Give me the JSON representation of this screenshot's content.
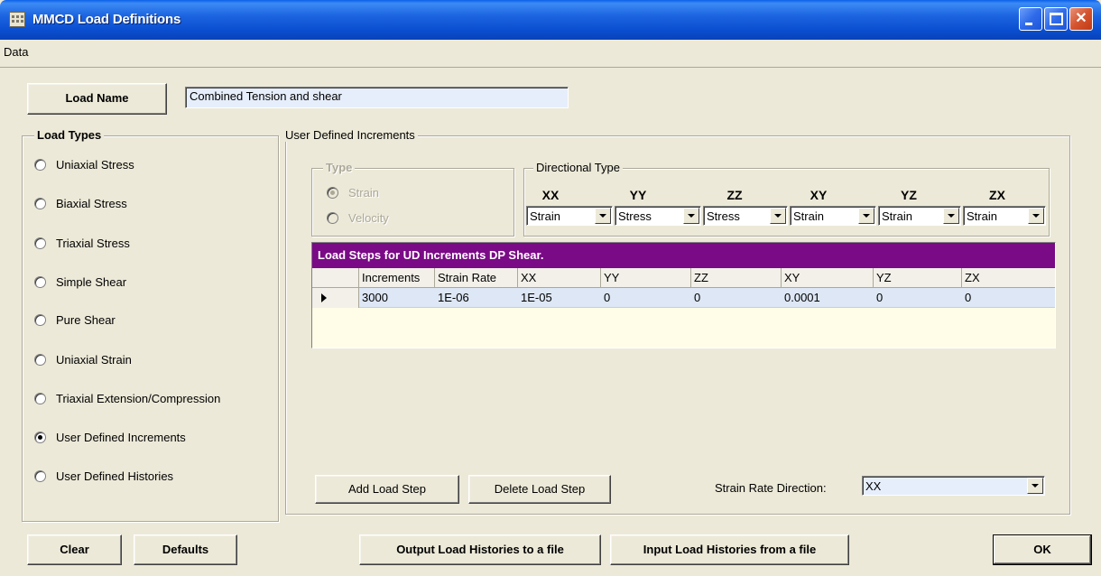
{
  "window": {
    "title": "MMCD Load Definitions"
  },
  "menu": {
    "items": [
      "Data"
    ]
  },
  "load_name": {
    "button_label": "Load Name",
    "value": "Combined Tension and shear"
  },
  "load_types": {
    "title": "Load Types",
    "options": [
      "Uniaxial Stress",
      "Biaxial Stress",
      "Triaxial Stress",
      "Simple Shear",
      "Pure Shear",
      "Uniaxial Strain",
      "Triaxial Extension/Compression",
      "User Defined Increments",
      "User Defined Histories"
    ],
    "selected": "User Defined Increments"
  },
  "ud_increments": {
    "title": "User Defined Increments",
    "type": {
      "title": "Type",
      "options": [
        "Strain",
        "Velocity"
      ],
      "selected": "Strain",
      "enabled": false
    },
    "directional_type": {
      "title": "Directional Type",
      "columns": [
        {
          "name": "XX",
          "value": "Strain"
        },
        {
          "name": "YY",
          "value": "Stress"
        },
        {
          "name": "ZZ",
          "value": "Stress"
        },
        {
          "name": "XY",
          "value": "Strain"
        },
        {
          "name": "YZ",
          "value": "Strain"
        },
        {
          "name": "ZX",
          "value": "Strain"
        }
      ]
    },
    "grid": {
      "caption": "Load Steps for UD Increments DP Shear.",
      "headers": [
        "Increments",
        "Strain Rate",
        "XX",
        "YY",
        "ZZ",
        "XY",
        "YZ",
        "ZX"
      ],
      "rows": [
        [
          "3000",
          "1E-06",
          "1E-05",
          "0",
          "0",
          "0.0001",
          "0",
          "0"
        ]
      ]
    },
    "add_step_label": "Add Load Step",
    "delete_step_label": "Delete Load Step",
    "strain_rate_direction": {
      "label": "Strain Rate Direction:",
      "value": "XX"
    }
  },
  "footer": {
    "clear_label": "Clear",
    "defaults_label": "Defaults",
    "output_label": "Output Load Histories to a file",
    "input_label": "Input Load Histories from a file",
    "ok_label": "OK"
  },
  "colors": {
    "title_bar": "#0A4FD0",
    "grid_caption": "#7A0A86",
    "dialog_bg": "#ECE9D8"
  }
}
